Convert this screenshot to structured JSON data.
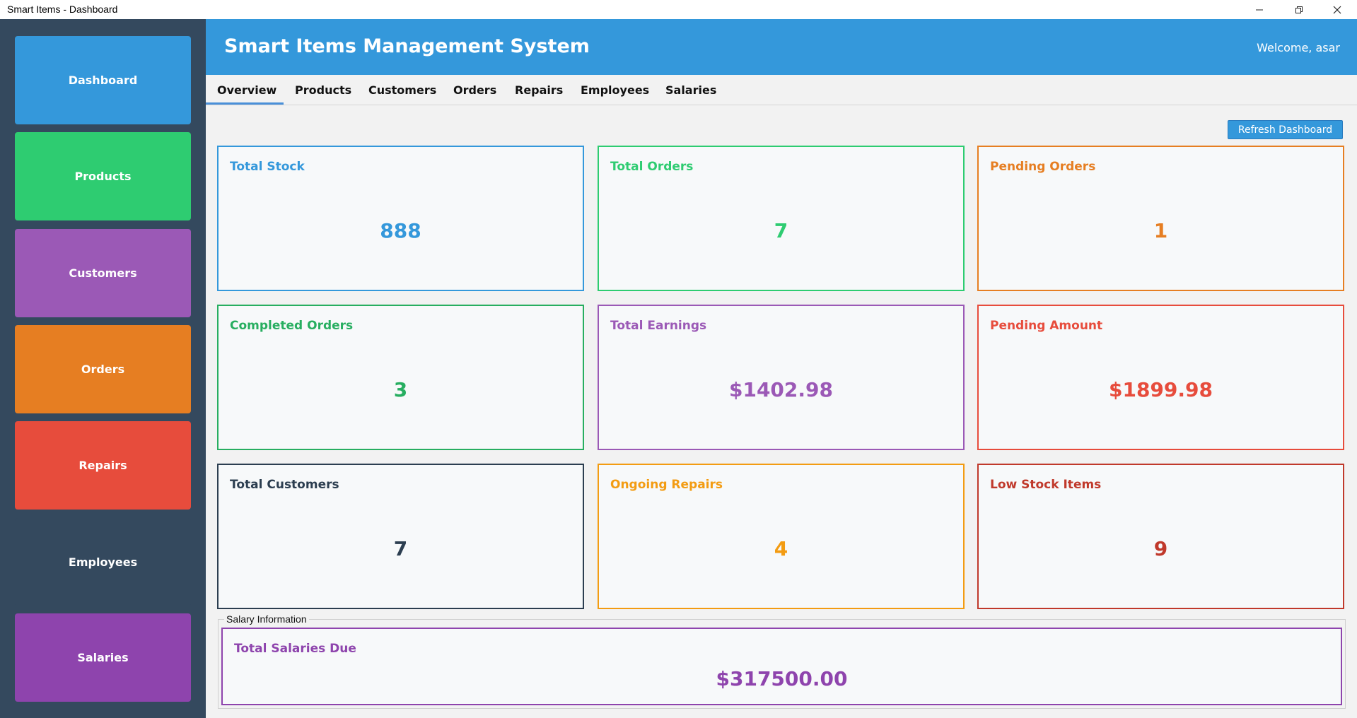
{
  "window": {
    "title": "Smart Items - Dashboard",
    "minimize_icon": "minimize-icon",
    "maximize_icon": "restore-icon",
    "close_icon": "close-icon"
  },
  "sidebar": {
    "items": [
      {
        "label": "Dashboard",
        "color": "#3498db"
      },
      {
        "label": "Products",
        "color": "#2ecc71"
      },
      {
        "label": "Customers",
        "color": "#9b59b6"
      },
      {
        "label": "Orders",
        "color": "#e67e22"
      },
      {
        "label": "Repairs",
        "color": "#e74c3c"
      },
      {
        "label": "Employees",
        "color": "#34495e"
      },
      {
        "label": "Salaries",
        "color": "#8e44ad"
      }
    ]
  },
  "header": {
    "title": "Smart Items Management System",
    "welcome": "Welcome, asar"
  },
  "tabs": [
    "Overview",
    "Products",
    "Customers",
    "Orders",
    "Repairs",
    "Employees",
    "Salaries"
  ],
  "active_tab": "Overview",
  "toolbar": {
    "refresh_label": "Refresh Dashboard"
  },
  "cards": [
    {
      "title": "Total Stock",
      "value": "888",
      "color": "#3498db"
    },
    {
      "title": "Total Orders",
      "value": "7",
      "color": "#2ecc71"
    },
    {
      "title": "Pending Orders",
      "value": "1",
      "color": "#e67e22"
    },
    {
      "title": "Completed Orders",
      "value": "3",
      "color": "#27ae60"
    },
    {
      "title": "Total Earnings",
      "value": "$1402.98",
      "color": "#9b59b6"
    },
    {
      "title": "Pending Amount",
      "value": "$1899.98",
      "color": "#e74c3c"
    },
    {
      "title": "Total Customers",
      "value": "7",
      "color": "#2c3e50"
    },
    {
      "title": "Ongoing Repairs",
      "value": "4",
      "color": "#f39c12"
    },
    {
      "title": "Low Stock Items",
      "value": "9",
      "color": "#c0392b"
    }
  ],
  "salary": {
    "group_label": "Salary Information",
    "title": "Total Salaries Due",
    "value": "$317500.00"
  }
}
